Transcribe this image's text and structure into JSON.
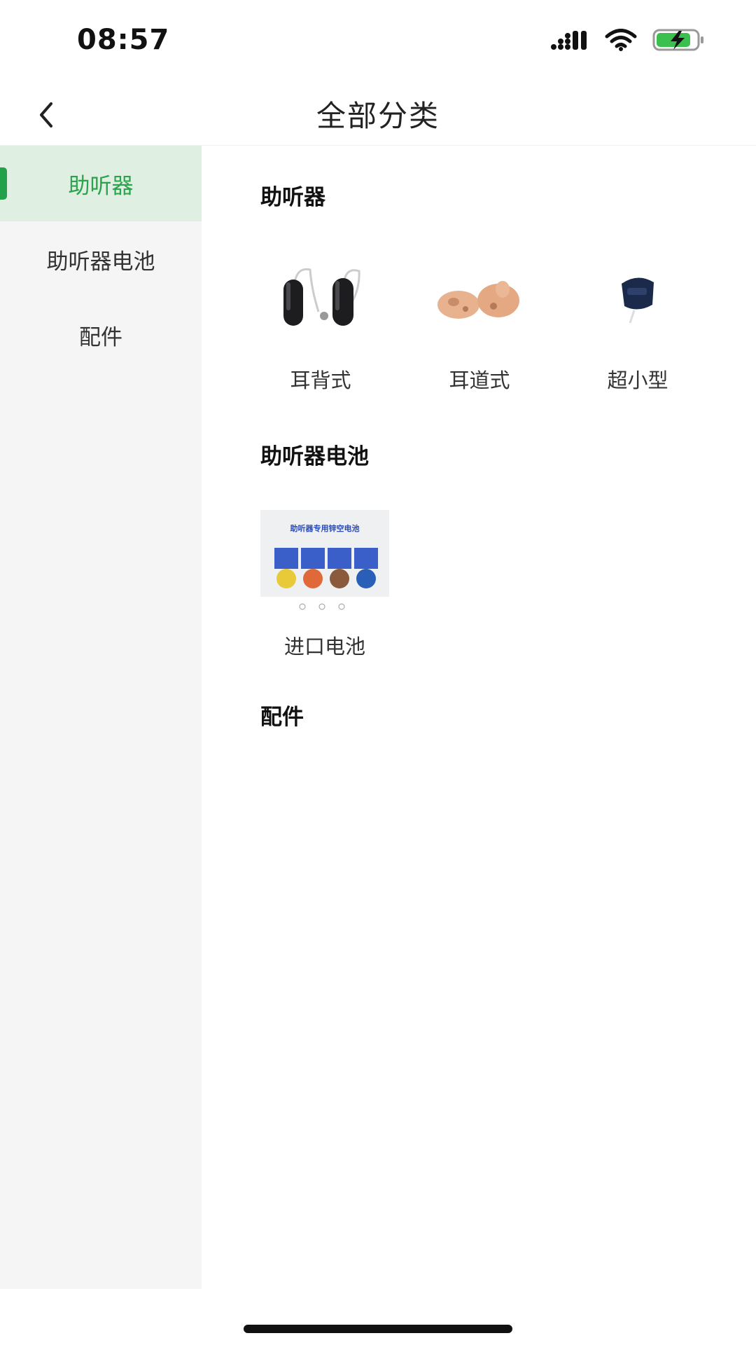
{
  "status": {
    "time": "08:57"
  },
  "nav": {
    "title": "全部分类"
  },
  "sidebar": {
    "items": [
      {
        "label": "助听器",
        "active": true
      },
      {
        "label": "助听器电池",
        "active": false
      },
      {
        "label": "配件",
        "active": false
      }
    ]
  },
  "sections": [
    {
      "title": "助听器",
      "products": [
        {
          "label": "耳背式",
          "icon": "bte-hearing-aid-icon"
        },
        {
          "label": "耳道式",
          "icon": "ite-hearing-aid-icon"
        },
        {
          "label": "超小型",
          "icon": "cic-hearing-aid-icon"
        }
      ]
    },
    {
      "title": "助听器电池",
      "products": [
        {
          "label": "进口电池",
          "icon": "battery-pack-image",
          "image_caption": "助听器专用锌空电池"
        }
      ]
    },
    {
      "title": "配件",
      "products": []
    }
  ],
  "colors": {
    "accent": "#2ba24c",
    "active_bg": "#dff0e3",
    "sidebar_bg": "#f5f5f5"
  }
}
